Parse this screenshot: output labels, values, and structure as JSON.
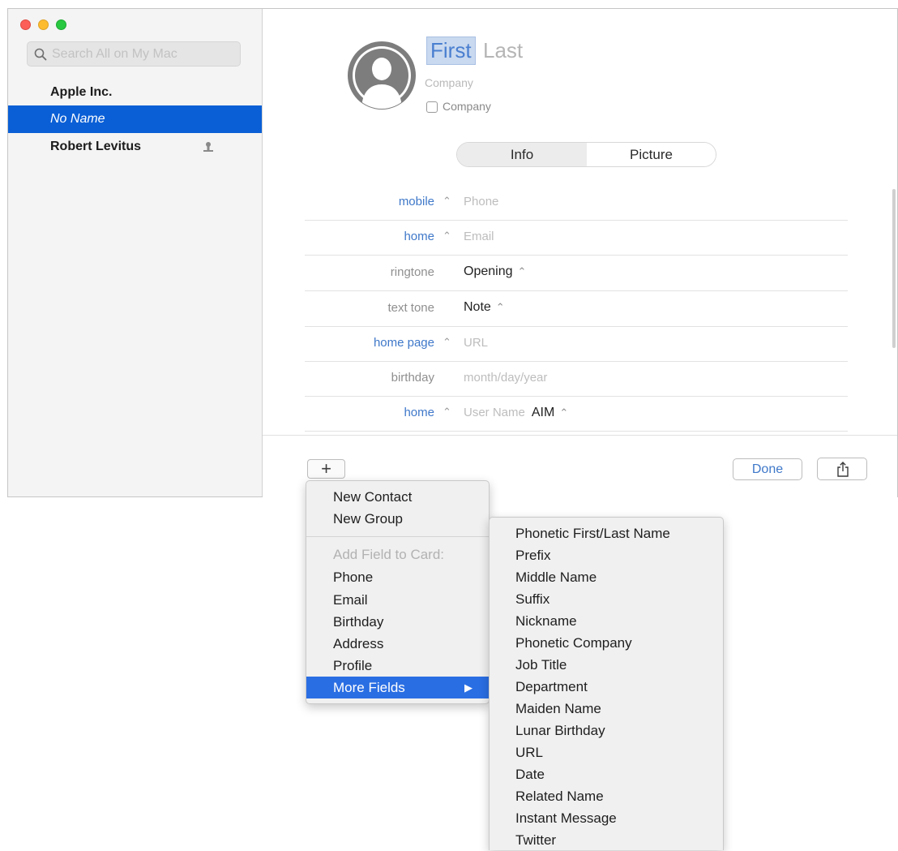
{
  "sidebar": {
    "search_placeholder": "Search All on My Mac",
    "contacts": [
      {
        "name": "Apple Inc."
      },
      {
        "name": "No Name"
      },
      {
        "name": "Robert Levitus"
      }
    ]
  },
  "card": {
    "first_name_placeholder": "First",
    "last_name_placeholder": "Last",
    "company_placeholder": "Company",
    "company_checkbox_label": "Company",
    "tabs": [
      "Info",
      "Picture"
    ],
    "fields": [
      {
        "label": "mobile",
        "value": "Phone"
      },
      {
        "label": "home",
        "value": "Email"
      },
      {
        "label": "ringtone",
        "value": "Opening"
      },
      {
        "label": "text tone",
        "value": "Note"
      },
      {
        "label": "home page",
        "value": "URL"
      },
      {
        "label": "birthday",
        "value": "month/day/year"
      },
      {
        "label": "home",
        "value": "User Name",
        "service": "AIM"
      }
    ],
    "stepper_glyph": "⌃",
    "add_label": "+",
    "done_label": "Done"
  },
  "add_menu": {
    "items": [
      "New Contact",
      "New Group"
    ],
    "section_header": "Add Field to Card:",
    "fields": [
      "Phone",
      "Email",
      "Birthday",
      "Address",
      "Profile"
    ],
    "more_fields": "More Fields",
    "submenu_arrow": "▶"
  },
  "more_fields_menu": {
    "items": [
      "Phonetic First/Last Name",
      "Prefix",
      "Middle Name",
      "Suffix",
      "Nickname",
      "Phonetic Company",
      "Job Title",
      "Department",
      "Maiden Name",
      "Lunar Birthday",
      "URL",
      "Date",
      "Related Name",
      "Instant Message",
      "Twitter"
    ]
  },
  "colors": {
    "selection": "#0a5fd6",
    "menu_highlight": "#2a6ee3",
    "label_blue": "#3f78c9"
  }
}
